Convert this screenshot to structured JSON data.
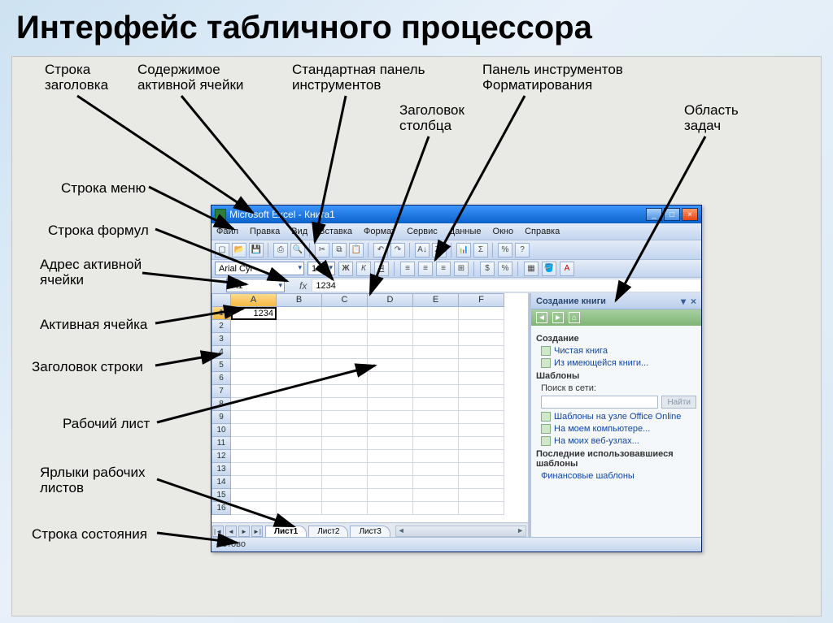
{
  "slide": {
    "title": "Интерфейс табличного процессора"
  },
  "annotations": {
    "title_row": "Строка\nзаголовка",
    "cell_content": "Содержимое\nактивной ячейки",
    "std_toolbar": "Стандартная панель\nинструментов",
    "fmt_toolbar": "Панель инструментов\nФорматирования",
    "col_header": "Заголовок\nстолбца",
    "task_pane": "Область\nзадач",
    "menu_row": "Строка меню",
    "formula_row": "Строка формул",
    "active_addr": "Адрес активной\nячейки",
    "active_cell": "Активная ячейка",
    "row_header": "Заголовок строки",
    "worksheet": "Рабочий лист",
    "sheet_tabs": "Ярлыки рабочих\nлистов",
    "status_row": "Строка состояния"
  },
  "window": {
    "title": "Microsoft Excel - Книга1",
    "menus": [
      "Файл",
      "Правка",
      "Вид",
      "Вставка",
      "Формат",
      "Сервис",
      "Данные",
      "Окно",
      "Справка"
    ],
    "font_name": "Arial Cyr",
    "font_size": "10",
    "name_box": "A1",
    "formula": "1234",
    "columns": [
      "A",
      "B",
      "C",
      "D",
      "E",
      "F"
    ],
    "row_count": 16,
    "active_cell_value": "1234",
    "sheet_tabs": [
      "Лист1",
      "Лист2",
      "Лист3"
    ],
    "status": "Готово"
  },
  "taskpane": {
    "title": "Создание книги",
    "section_create": "Создание",
    "link_blank": "Чистая книга",
    "link_existing": "Из имеющейся книги...",
    "section_templates": "Шаблоны",
    "search_label": "Поиск в сети:",
    "search_btn": "Найти",
    "link_office": "Шаблоны на узле Office Online",
    "link_mycomp": "На моем компьютере...",
    "link_mysites": "На моих веб-узлах...",
    "section_recent": "Последние использовавшиеся\nшаблоны",
    "link_fin": "Финансовые шаблоны"
  }
}
